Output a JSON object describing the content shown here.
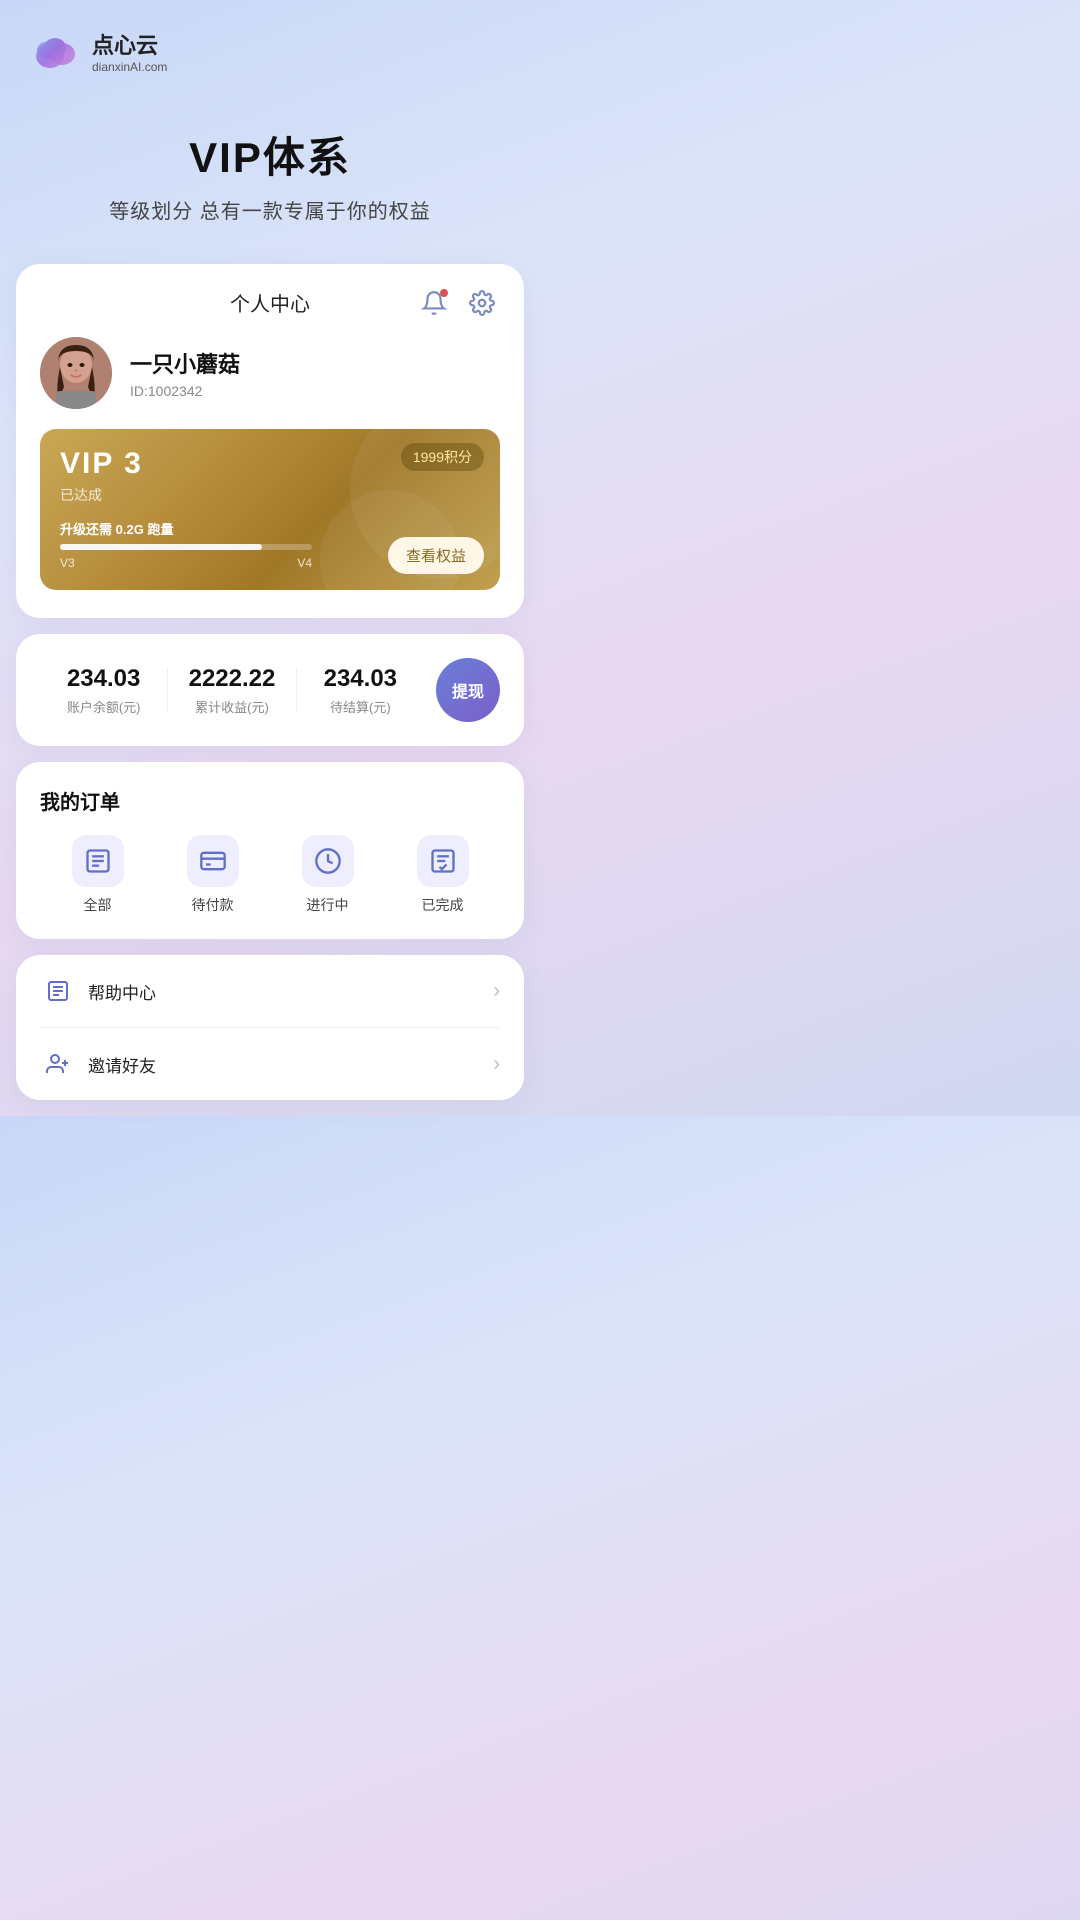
{
  "logo": {
    "name": "点心云",
    "domain": "dianxinAI.com"
  },
  "hero": {
    "title": "VIP体系",
    "subtitle": "等级划分 总有一款专属于你的权益"
  },
  "personal_center": {
    "title": "个人中心",
    "notification_label": "通知",
    "settings_label": "设置"
  },
  "user": {
    "name": "一只小蘑菇",
    "id_label": "ID:1002342"
  },
  "vip_card": {
    "level": "VIP  3",
    "achieved_label": "已达成",
    "points": "1999积分",
    "upgrade_text": "升级还需",
    "upgrade_amount": "0.2G",
    "upgrade_unit": "跑量",
    "progress_from": "V3",
    "progress_to": "V4",
    "view_benefits_label": "查看权益",
    "progress_percent": 80
  },
  "finance": {
    "balance": "234.03",
    "balance_label": "账户余额(元)",
    "total_income": "2222.22",
    "total_income_label": "累计收益(元)",
    "pending": "234.03",
    "pending_label": "待结算(元)",
    "withdraw_label": "提现"
  },
  "orders": {
    "title": "我的订单",
    "items": [
      {
        "id": "all",
        "label": "全部"
      },
      {
        "id": "pending-payment",
        "label": "待付款"
      },
      {
        "id": "in-progress",
        "label": "进行中"
      },
      {
        "id": "completed",
        "label": "已完成"
      }
    ]
  },
  "menu_items": [
    {
      "id": "help-center",
      "label": "帮助中心"
    },
    {
      "id": "invite-friends",
      "label": "邀请好友"
    }
  ]
}
